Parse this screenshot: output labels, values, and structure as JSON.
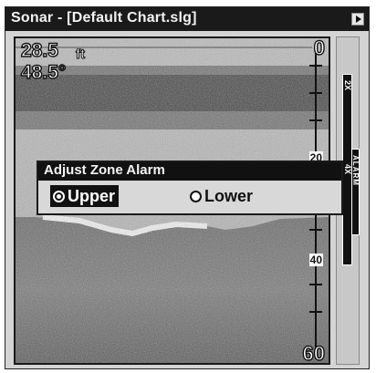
{
  "window": {
    "title": "Sonar - [Default Chart.slg]"
  },
  "readouts": {
    "depth": "28.5",
    "depth_unit": "ft",
    "temperature": "48.5°"
  },
  "depth_scale": {
    "top": "0",
    "tick_20": "20",
    "tick_40": "40",
    "bottom": "60"
  },
  "zoom_bar": {
    "label_2x": "2X",
    "label_4x": "4X"
  },
  "alarm_bar": {
    "label": "ALARM"
  },
  "dialog": {
    "title": "Adjust Zone Alarm",
    "options": [
      {
        "label": "Upper",
        "selected": true
      },
      {
        "label": "Lower",
        "selected": false
      }
    ]
  },
  "colors": {
    "frame": "#1a1a1a",
    "background": "#bdbdbd",
    "highlight": "#111111"
  },
  "icons": {
    "title_menu": "play-triangle-icon"
  }
}
